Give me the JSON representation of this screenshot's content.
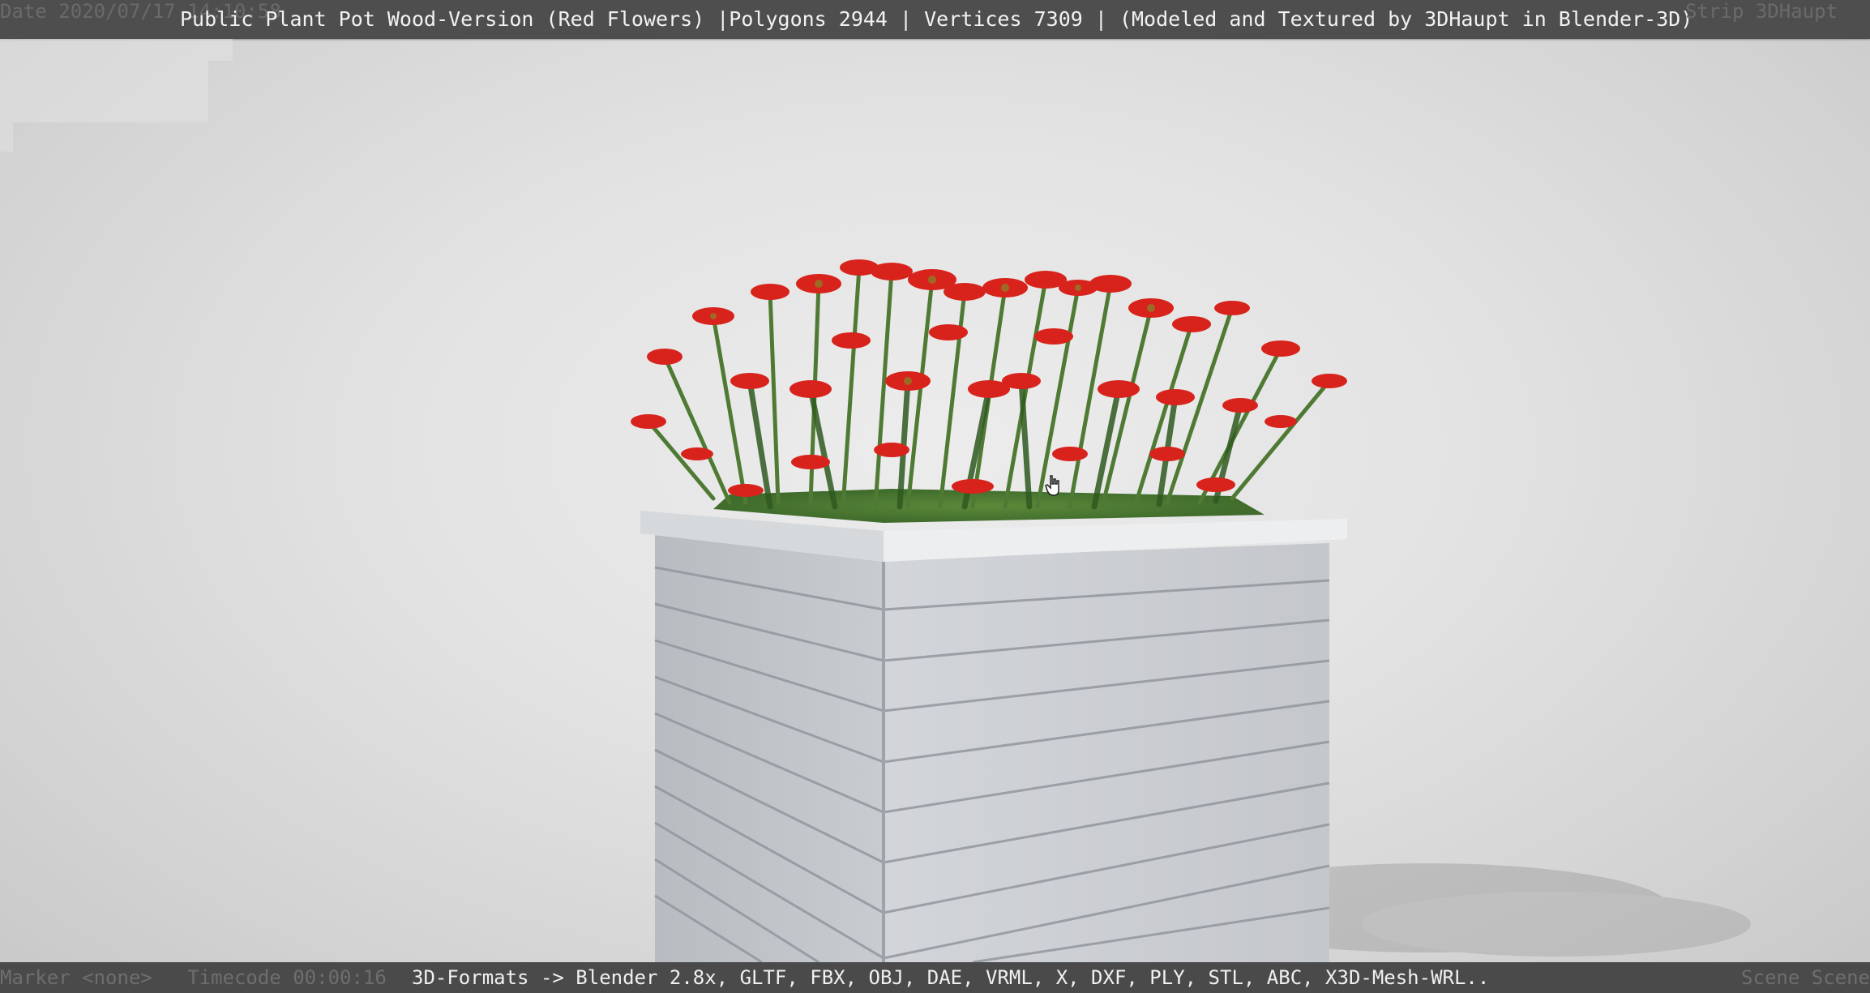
{
  "header": {
    "title": "Public Plant Pot Wood-Version (Red Flowers) |Polygons 2944 | Vertices 7309 | (Modeled and Textured by 3DHaupt in Blender-3D)",
    "ghost_left": "Date 2020/07/17 14:10:58",
    "ghost_right": "Strip 3DHaupt"
  },
  "footer": {
    "formats": "3D-Formats -> Blender 2.8x, GLTF, FBX, OBJ, DAE, VRML, X, DXF, PLY, STL, ABC, X3D-Mesh-WRL..",
    "ghost_left": "Marker <none>   Timecode 00:00:16",
    "ghost_right": "Scene Scene"
  },
  "scene": {
    "object": "wooden plant pot with red flowers",
    "colors": {
      "background": "#e2e2e2",
      "pot_wood": "#c9ccd0",
      "flower_red": "#d8231c",
      "leaf_green": "#3f6b2c",
      "bar": "#4e4e4e"
    }
  },
  "cursor": {
    "icon": "hand-cursor-icon"
  }
}
